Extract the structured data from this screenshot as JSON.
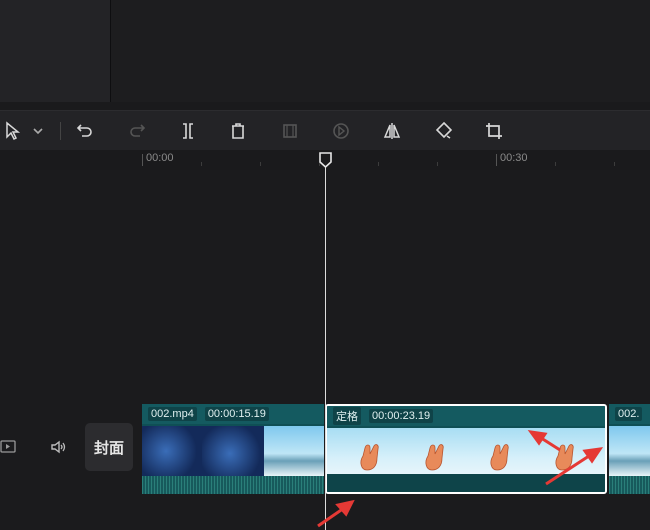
{
  "toolbar": {
    "items": [
      "select-tool",
      "undo",
      "redo",
      "split",
      "delete",
      "freeze",
      "reverse",
      "mirror",
      "rotate",
      "crop"
    ]
  },
  "ruler": {
    "start_label": "00:00",
    "mark_label": "00:30"
  },
  "track": {
    "cover_label": "封面"
  },
  "clips": [
    {
      "name": "002.mp4",
      "duration": "00:00:15.19"
    },
    {
      "name": "定格",
      "duration": "00:00:23.19"
    },
    {
      "name": "002."
    }
  ],
  "colors": {
    "clip_bg": "#0f4f55",
    "selected_border": "#ffffff",
    "annotation_arrow": "#e53935"
  }
}
